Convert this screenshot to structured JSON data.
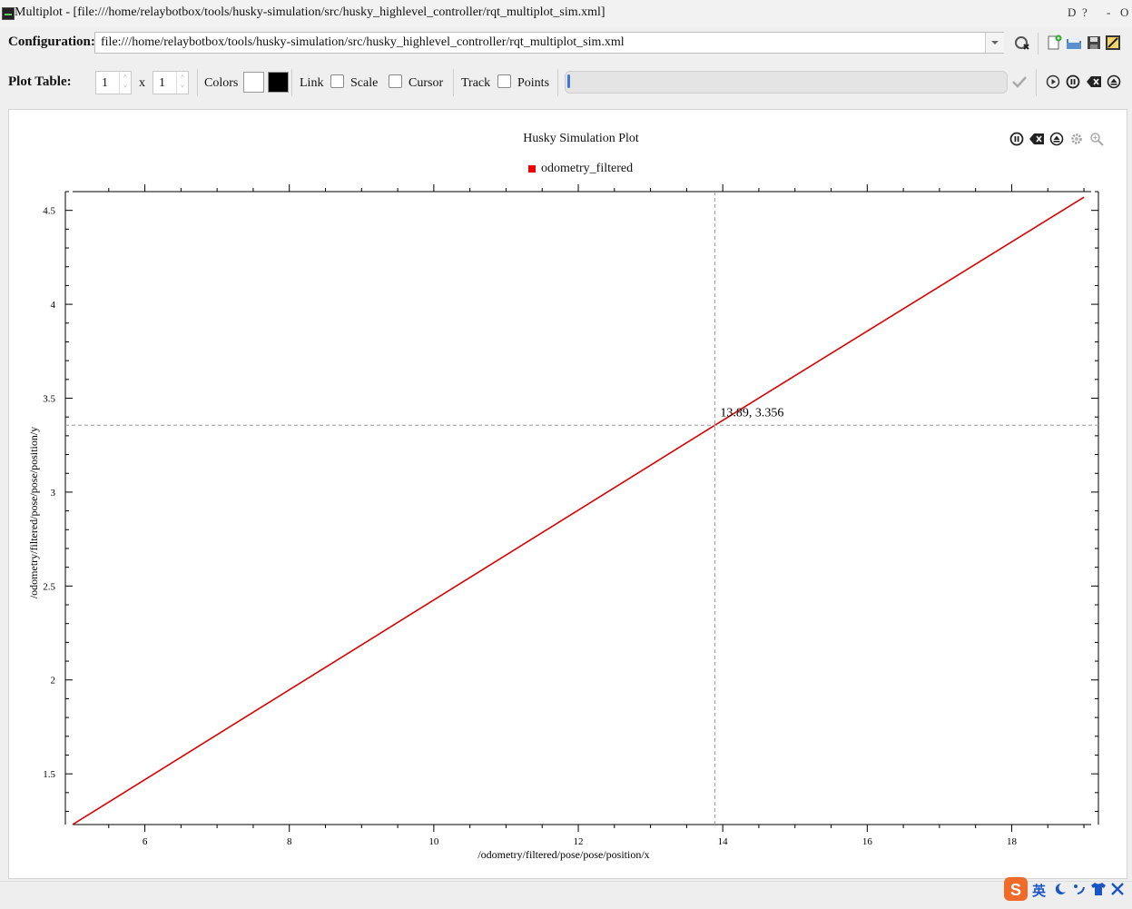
{
  "window": {
    "title": "Multiplot - [file:///home/relaybotbox/tools/husky-simulation/src/husky_highlevel_controller/rqt_multiplot_sim.xml]",
    "buttons": [
      "D",
      "?",
      "-",
      "O"
    ]
  },
  "config": {
    "label": "Configuration:",
    "value": "file:///home/relaybotbox/tools/husky-simulation/src/husky_highlevel_controller/rqt_multiplot_sim.xml"
  },
  "plot_table": {
    "label": "Plot Table:",
    "rows": "1",
    "cols": "1",
    "x_label": "x",
    "colors_label": "Colors",
    "link_label": "Link",
    "scale_label": "Scale",
    "cursor_label": "Cursor",
    "track_label": "Track",
    "points_label": "Points",
    "progress": 0.005
  },
  "plot": {
    "title": "Husky Simulation Plot",
    "legend": "odometry_filtered",
    "cursor_readout": "13.89, 3.356"
  },
  "colors": {
    "series": "#dd0000",
    "background": "#ffffff",
    "foreground": "#000000",
    "accent": "#3e78d6"
  },
  "chart_data": {
    "type": "line",
    "title": "Husky Simulation Plot",
    "xlabel": "/odometry/filtered/pose/pose/position/x",
    "ylabel": "/odometry/filtered/pose/pose/position/y",
    "xlim": [
      5,
      19.1
    ],
    "ylim": [
      1.23,
      4.6
    ],
    "x_ticks": [
      6,
      8,
      10,
      12,
      14,
      16,
      18
    ],
    "y_ticks": [
      1.5,
      2,
      2.5,
      3,
      3.5,
      4,
      4.5
    ],
    "y_tick_labels": [
      "1.5",
      "2",
      "2.5",
      "3",
      "3.5",
      "4",
      "4.5"
    ],
    "series": [
      {
        "name": "odometry_filtered",
        "color": "#dd0000",
        "x": [
          5.0,
          13.89,
          19.0
        ],
        "y": [
          1.23,
          3.356,
          4.57
        ]
      }
    ],
    "cursor": {
      "x": 13.89,
      "y": 3.356
    },
    "legend": "top-center",
    "grid": false
  },
  "tray": {
    "ime_label": "英"
  }
}
